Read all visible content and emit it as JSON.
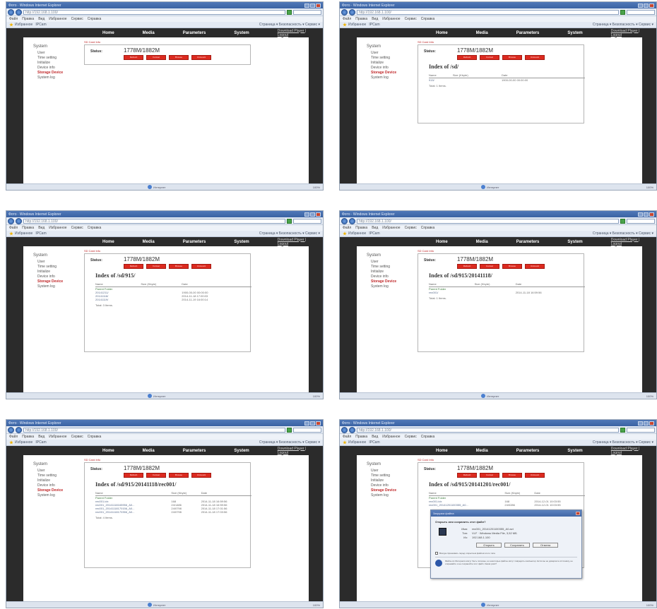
{
  "window": {
    "title": "Фото · Windows Internet Explorer",
    "address": "http://192.168.1.100/",
    "menu": [
      "Файл",
      "Правка",
      "Вид",
      "Избранное",
      "Сервис",
      "Справка"
    ],
    "favorites_label": "Избранное",
    "fav_link": "IPCam",
    "tools_label": "Страница ▾  Безопасность ▾  Сервис ▾",
    "status_zone": "Интернет",
    "zoom": "100%"
  },
  "site": {
    "nav": [
      "Home",
      "Media",
      "Parameters",
      "System"
    ],
    "download_link": "Download Player | Logout",
    "sidebar_title": "System",
    "sidebar_items": [
      "User",
      "Time setting",
      "Initialize",
      "Device info",
      "Storage Device",
      "System log"
    ],
    "sd_label": "SD Card Info",
    "status_key": "Status:",
    "status_value": "1778M/1882M",
    "sd_buttons": [
      "Refresh",
      "Format",
      "Browse",
      "Unmount"
    ],
    "col_headers": [
      "Name",
      "Size (Kbyte)",
      "Date"
    ]
  },
  "screens": [
    {
      "status_value": "1778M/1882M",
      "index_title": "",
      "rows": [],
      "total": ""
    },
    {
      "status_value": "1778M/1882M",
      "index_title": "Index of /sd/",
      "rows": [
        {
          "name": "915/",
          "size": "",
          "date": "1900-00-00 00:00:00"
        }
      ],
      "total": "Total: 1 Items."
    },
    {
      "status_value": "1778M/1882M",
      "index_title": "Index of /sd/915/",
      "rows": [
        {
          "name": "Parent Folder",
          "size": "",
          "date": ""
        },
        {
          "name": "20141211/",
          "size": "",
          "date": "1900-00-00 00:00:00"
        },
        {
          "name": "20141118/",
          "size": "",
          "date": "2014-11-18 17:00:03"
        },
        {
          "name": "20141119/",
          "size": "",
          "date": "2014-11-19 16:00:14"
        }
      ],
      "total": "Total: 3 Items."
    },
    {
      "status_value": "1778M/1882M",
      "index_title": "Index of /sd/915/20141118/",
      "rows": [
        {
          "name": "Parent Folder",
          "size": "",
          "date": ""
        },
        {
          "name": "rec001/",
          "size": "",
          "date": "2014-11-18 16:59:56"
        }
      ],
      "total": "Total: 1 Items."
    },
    {
      "status_value": "1778M/1882M",
      "index_title": "Index of /sd/915/20141118/rec001/",
      "rows": [
        {
          "name": "Parent Folder",
          "size": "",
          "date": ""
        },
        {
          "name": "rec001.idx",
          "size": "168",
          "date": "2014-11-18 16:59:56"
        },
        {
          "name": "rec001_20141118165956_A0...",
          "size": "24/1486",
          "date": "2014-11-18 16:59:56"
        },
        {
          "name": "rec001_20141118170156_A0...",
          "size": "24/0798",
          "date": "2014-11-18 17:01:56"
        },
        {
          "name": "rec001_20141118170356_A0...",
          "size": "24/0798",
          "date": "2014-11-18 17:03:56"
        }
      ],
      "total": "Total: 4 Items."
    },
    {
      "status_value": "1778M/1882M",
      "index_title": "Index of /sd/915/20141201/rec001/",
      "rows": [
        {
          "name": "Parent Folder",
          "size": "",
          "date": ""
        },
        {
          "name": "rec001.idx",
          "size": "168",
          "date": "2014-12-01 10:03:55"
        },
        {
          "name": "rec001_20141201100355_A0...",
          "size": "24/0286",
          "date": "2014-12-01 10:03:55"
        }
      ],
      "total": ""
    }
  ],
  "dialog": {
    "title": "Загрузка файла",
    "question": "Открыть или сохранить этот файл?",
    "name_key": "Имя:",
    "name_val": "rec001_20141201100355_A0.avi",
    "type_key": "Тип:",
    "type_val": "VLF · Windows Media File, 3,52 МБ",
    "from_key": "Из:",
    "from_val": "192.168.1.100",
    "buttons": [
      "Открыть",
      "Сохранить",
      "Отмена"
    ],
    "checkbox": "Всегда спрашивать перед открытием файлов этого типа",
    "warning": "Файлы из Интернета могут быть полезны, но некоторые файлы могут повредить компьютер. Если вы не доверяете источнику, не открывайте и не сохраняйте этот файл. Каков риск?"
  }
}
